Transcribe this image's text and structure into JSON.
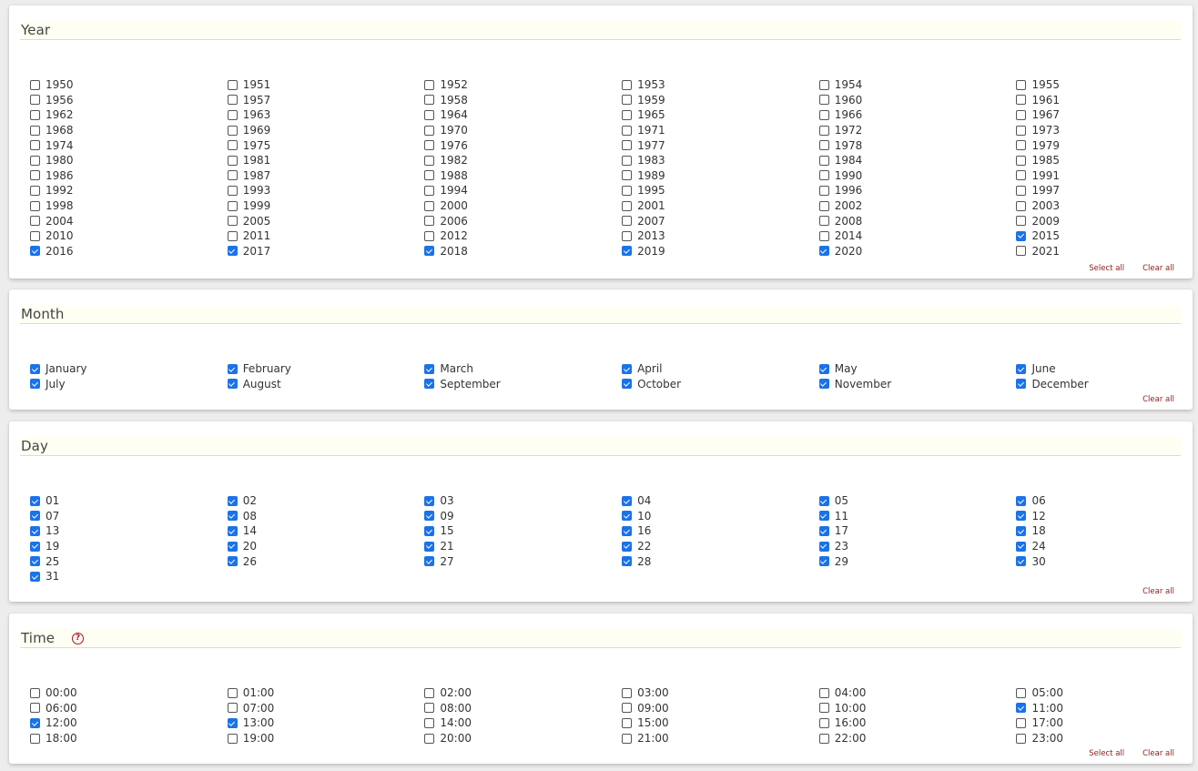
{
  "sections": {
    "year": {
      "title": "Year",
      "select_all": "Select all",
      "clear_all": "Clear all",
      "options": [
        {
          "label": "1950",
          "checked": false
        },
        {
          "label": "1951",
          "checked": false
        },
        {
          "label": "1952",
          "checked": false
        },
        {
          "label": "1953",
          "checked": false
        },
        {
          "label": "1954",
          "checked": false
        },
        {
          "label": "1955",
          "checked": false
        },
        {
          "label": "1956",
          "checked": false
        },
        {
          "label": "1957",
          "checked": false
        },
        {
          "label": "1958",
          "checked": false
        },
        {
          "label": "1959",
          "checked": false
        },
        {
          "label": "1960",
          "checked": false
        },
        {
          "label": "1961",
          "checked": false
        },
        {
          "label": "1962",
          "checked": false
        },
        {
          "label": "1963",
          "checked": false
        },
        {
          "label": "1964",
          "checked": false
        },
        {
          "label": "1965",
          "checked": false
        },
        {
          "label": "1966",
          "checked": false
        },
        {
          "label": "1967",
          "checked": false
        },
        {
          "label": "1968",
          "checked": false
        },
        {
          "label": "1969",
          "checked": false
        },
        {
          "label": "1970",
          "checked": false
        },
        {
          "label": "1971",
          "checked": false
        },
        {
          "label": "1972",
          "checked": false
        },
        {
          "label": "1973",
          "checked": false
        },
        {
          "label": "1974",
          "checked": false
        },
        {
          "label": "1975",
          "checked": false
        },
        {
          "label": "1976",
          "checked": false
        },
        {
          "label": "1977",
          "checked": false
        },
        {
          "label": "1978",
          "checked": false
        },
        {
          "label": "1979",
          "checked": false
        },
        {
          "label": "1980",
          "checked": false
        },
        {
          "label": "1981",
          "checked": false
        },
        {
          "label": "1982",
          "checked": false
        },
        {
          "label": "1983",
          "checked": false
        },
        {
          "label": "1984",
          "checked": false
        },
        {
          "label": "1985",
          "checked": false
        },
        {
          "label": "1986",
          "checked": false
        },
        {
          "label": "1987",
          "checked": false
        },
        {
          "label": "1988",
          "checked": false
        },
        {
          "label": "1989",
          "checked": false
        },
        {
          "label": "1990",
          "checked": false
        },
        {
          "label": "1991",
          "checked": false
        },
        {
          "label": "1992",
          "checked": false
        },
        {
          "label": "1993",
          "checked": false
        },
        {
          "label": "1994",
          "checked": false
        },
        {
          "label": "1995",
          "checked": false
        },
        {
          "label": "1996",
          "checked": false
        },
        {
          "label": "1997",
          "checked": false
        },
        {
          "label": "1998",
          "checked": false
        },
        {
          "label": "1999",
          "checked": false
        },
        {
          "label": "2000",
          "checked": false
        },
        {
          "label": "2001",
          "checked": false
        },
        {
          "label": "2002",
          "checked": false
        },
        {
          "label": "2003",
          "checked": false
        },
        {
          "label": "2004",
          "checked": false
        },
        {
          "label": "2005",
          "checked": false
        },
        {
          "label": "2006",
          "checked": false
        },
        {
          "label": "2007",
          "checked": false
        },
        {
          "label": "2008",
          "checked": false
        },
        {
          "label": "2009",
          "checked": false
        },
        {
          "label": "2010",
          "checked": false
        },
        {
          "label": "2011",
          "checked": false
        },
        {
          "label": "2012",
          "checked": false
        },
        {
          "label": "2013",
          "checked": false
        },
        {
          "label": "2014",
          "checked": false
        },
        {
          "label": "2015",
          "checked": true
        },
        {
          "label": "2016",
          "checked": true
        },
        {
          "label": "2017",
          "checked": true
        },
        {
          "label": "2018",
          "checked": true
        },
        {
          "label": "2019",
          "checked": true
        },
        {
          "label": "2020",
          "checked": true
        },
        {
          "label": "2021",
          "checked": false
        }
      ]
    },
    "month": {
      "title": "Month",
      "clear_all": "Clear all",
      "options": [
        {
          "label": "January",
          "checked": true
        },
        {
          "label": "February",
          "checked": true
        },
        {
          "label": "March",
          "checked": true
        },
        {
          "label": "April",
          "checked": true
        },
        {
          "label": "May",
          "checked": true
        },
        {
          "label": "June",
          "checked": true
        },
        {
          "label": "July",
          "checked": true
        },
        {
          "label": "August",
          "checked": true
        },
        {
          "label": "September",
          "checked": true
        },
        {
          "label": "October",
          "checked": true
        },
        {
          "label": "November",
          "checked": true
        },
        {
          "label": "December",
          "checked": true
        }
      ]
    },
    "day": {
      "title": "Day",
      "clear_all": "Clear all",
      "options": [
        {
          "label": "01",
          "checked": true
        },
        {
          "label": "02",
          "checked": true
        },
        {
          "label": "03",
          "checked": true
        },
        {
          "label": "04",
          "checked": true
        },
        {
          "label": "05",
          "checked": true
        },
        {
          "label": "06",
          "checked": true
        },
        {
          "label": "07",
          "checked": true
        },
        {
          "label": "08",
          "checked": true
        },
        {
          "label": "09",
          "checked": true
        },
        {
          "label": "10",
          "checked": true
        },
        {
          "label": "11",
          "checked": true
        },
        {
          "label": "12",
          "checked": true
        },
        {
          "label": "13",
          "checked": true
        },
        {
          "label": "14",
          "checked": true
        },
        {
          "label": "15",
          "checked": true
        },
        {
          "label": "16",
          "checked": true
        },
        {
          "label": "17",
          "checked": true
        },
        {
          "label": "18",
          "checked": true
        },
        {
          "label": "19",
          "checked": true
        },
        {
          "label": "20",
          "checked": true
        },
        {
          "label": "21",
          "checked": true
        },
        {
          "label": "22",
          "checked": true
        },
        {
          "label": "23",
          "checked": true
        },
        {
          "label": "24",
          "checked": true
        },
        {
          "label": "25",
          "checked": true
        },
        {
          "label": "26",
          "checked": true
        },
        {
          "label": "27",
          "checked": true
        },
        {
          "label": "28",
          "checked": true
        },
        {
          "label": "29",
          "checked": true
        },
        {
          "label": "30",
          "checked": true
        },
        {
          "label": "31",
          "checked": true
        }
      ]
    },
    "time": {
      "title": "Time",
      "help_icon": "question-circle-icon",
      "help_glyph": "?",
      "select_all": "Select all",
      "clear_all": "Clear all",
      "options": [
        {
          "label": "00:00",
          "checked": false
        },
        {
          "label": "01:00",
          "checked": false
        },
        {
          "label": "02:00",
          "checked": false
        },
        {
          "label": "03:00",
          "checked": false
        },
        {
          "label": "04:00",
          "checked": false
        },
        {
          "label": "05:00",
          "checked": false
        },
        {
          "label": "06:00",
          "checked": false
        },
        {
          "label": "07:00",
          "checked": false
        },
        {
          "label": "08:00",
          "checked": false
        },
        {
          "label": "09:00",
          "checked": false
        },
        {
          "label": "10:00",
          "checked": false
        },
        {
          "label": "11:00",
          "checked": true
        },
        {
          "label": "12:00",
          "checked": true
        },
        {
          "label": "13:00",
          "checked": true
        },
        {
          "label": "14:00",
          "checked": false
        },
        {
          "label": "15:00",
          "checked": false
        },
        {
          "label": "16:00",
          "checked": false
        },
        {
          "label": "17:00",
          "checked": false
        },
        {
          "label": "18:00",
          "checked": false
        },
        {
          "label": "19:00",
          "checked": false
        },
        {
          "label": "20:00",
          "checked": false
        },
        {
          "label": "21:00",
          "checked": false
        },
        {
          "label": "22:00",
          "checked": false
        },
        {
          "label": "23:00",
          "checked": false
        }
      ]
    }
  },
  "colors": {
    "checkbox_checked": "#1a73e8",
    "action_link": "#8b1a1a",
    "header_band": "#fffef2",
    "page_background": "#ededed"
  }
}
